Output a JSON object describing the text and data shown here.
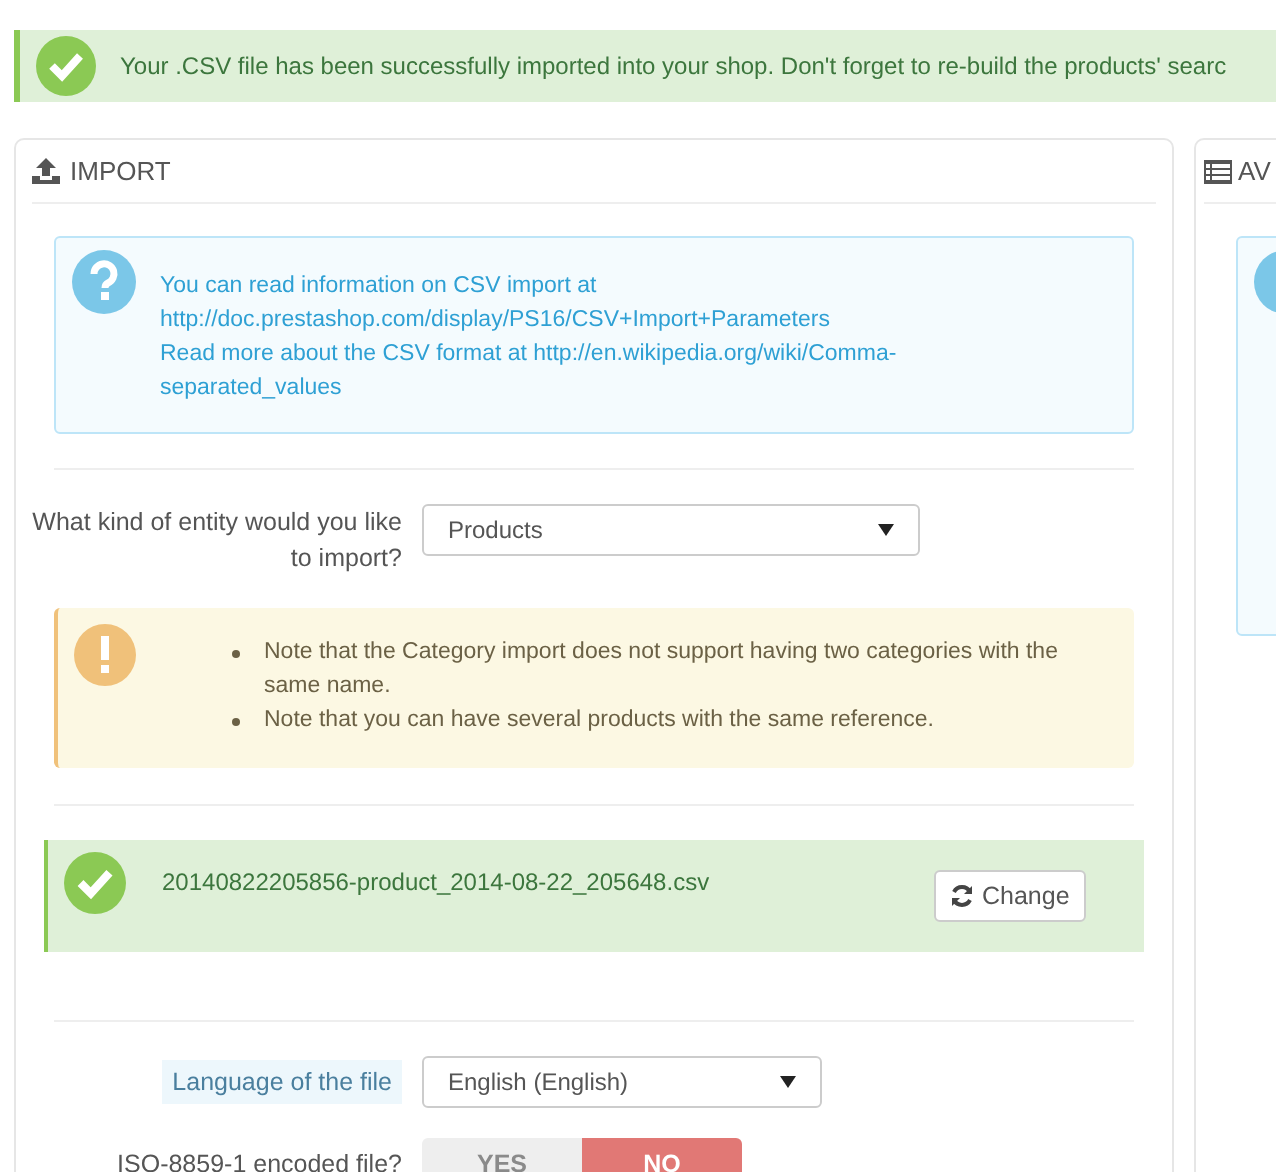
{
  "success_alert": {
    "text": "Your .CSV file has been successfully imported into your shop. Don't forget to re-build the products' searc"
  },
  "import_panel": {
    "title": "IMPORT",
    "info": {
      "lines": [
        "You can read information on CSV import at",
        "http://doc.prestashop.com/display/PS16/CSV+Import+Parameters",
        "Read more about the CSV format at http://en.wikipedia.org/wiki/Comma-separated_values"
      ]
    },
    "entity": {
      "label": "What kind of entity would you like to import?",
      "value": "Products"
    },
    "warnings": [
      "Note that the Category import does not support having two categories with the same name.",
      "Note that you can have several products with the same reference."
    ],
    "file": {
      "name": "20140822205856-product_2014-08-22_205648.csv",
      "button": "Change"
    },
    "language": {
      "label": "Language of the file",
      "value": "English (English)"
    },
    "encoding": {
      "label": "ISO-8859-1 encoded file?",
      "options": [
        {
          "label": "YES",
          "selected": false
        },
        {
          "label": "NO",
          "selected": true
        }
      ]
    }
  },
  "side_panel": {
    "title": "AV"
  }
}
